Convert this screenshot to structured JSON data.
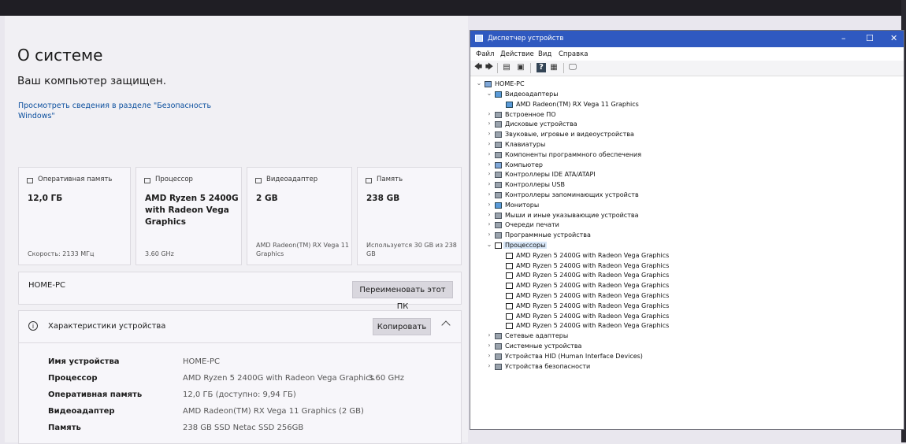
{
  "settings": {
    "title": "О системе",
    "protected_text": "Ваш компьютер защищен.",
    "security_link": "Просмотреть сведения в разделе \"Безопасность Windows\"",
    "cards": [
      {
        "label": "Оперативная память",
        "value": "12,0 ГБ",
        "sub": "Скорость: 2133 МГц"
      },
      {
        "label": "Процессор",
        "value": "AMD Ryzen 5 2400G with Radeon Vega Graphics",
        "sub": "3.60 GHz"
      },
      {
        "label": "Видеоадаптер",
        "value": "2 GB",
        "sub": "AMD Radeon(TM) RX Vega 11 Graphics"
      },
      {
        "label": "Память",
        "value": "238 GB",
        "sub": "Используется 30 GB из 238 GB"
      }
    ],
    "pc_name": "HOME-PC",
    "rename_button": "Переименовать этот ПК",
    "specs_title": "Характеристики устройства",
    "copy_button": "Копировать",
    "specs": [
      {
        "key": "Имя устройства",
        "value": "HOME-PC",
        "extra": ""
      },
      {
        "key": "Процессор",
        "value": "AMD Ryzen 5 2400G with Radeon Vega Graphics",
        "extra": "3.60 GHz"
      },
      {
        "key": "Оперативная память",
        "value": "12,0 ГБ (доступно: 9,94 ГБ)",
        "extra": ""
      },
      {
        "key": "Видеоадаптер",
        "value": "AMD Radeon(TM) RX Vega 11 Graphics (2 GB)",
        "extra": ""
      },
      {
        "key": "Память",
        "value": "238 GB SSD Netac SSD 256GB",
        "extra": ""
      }
    ]
  },
  "device_manager": {
    "title": "Диспетчер устройств",
    "menu": [
      "Файл",
      "Действие",
      "Вид",
      "Справка"
    ],
    "root": "HOME-PC",
    "nodes": [
      {
        "label": "Видеоадаптеры",
        "level": 1,
        "expanded": true,
        "icon": "display-adapter-icon"
      },
      {
        "label": "AMD Radeon(TM) RX Vega 11 Graphics",
        "level": 2,
        "icon": "display-adapter-icon"
      },
      {
        "label": "Встроенное ПО",
        "level": 1,
        "expanded": false,
        "icon": "firmware-icon"
      },
      {
        "label": "Дисковые устройства",
        "level": 1,
        "expanded": false,
        "icon": "disk-drive-icon"
      },
      {
        "label": "Звуковые, игровые и видеоустройства",
        "level": 1,
        "expanded": false,
        "icon": "sound-icon"
      },
      {
        "label": "Клавиатуры",
        "level": 1,
        "expanded": false,
        "icon": "keyboard-icon"
      },
      {
        "label": "Компоненты программного обеспечения",
        "level": 1,
        "expanded": false,
        "icon": "software-component-icon"
      },
      {
        "label": "Компьютер",
        "level": 1,
        "expanded": false,
        "icon": "computer-icon"
      },
      {
        "label": "Контроллеры IDE ATA/ATAPI",
        "level": 1,
        "expanded": false,
        "icon": "ide-controller-icon"
      },
      {
        "label": "Контроллеры USB",
        "level": 1,
        "expanded": false,
        "icon": "usb-icon"
      },
      {
        "label": "Контроллеры запоминающих устройств",
        "level": 1,
        "expanded": false,
        "icon": "storage-controller-icon"
      },
      {
        "label": "Мониторы",
        "level": 1,
        "expanded": false,
        "icon": "monitor-icon"
      },
      {
        "label": "Мыши и иные указывающие устройства",
        "level": 1,
        "expanded": false,
        "icon": "mouse-icon"
      },
      {
        "label": "Очереди печати",
        "level": 1,
        "expanded": false,
        "icon": "printer-icon"
      },
      {
        "label": "Программные устройства",
        "level": 1,
        "expanded": false,
        "icon": "software-device-icon"
      },
      {
        "label": "Процессоры",
        "level": 1,
        "expanded": true,
        "icon": "processor-icon"
      },
      {
        "label": "AMD Ryzen 5 2400G with Radeon Vega Graphics",
        "level": 2,
        "icon": "processor-icon"
      },
      {
        "label": "AMD Ryzen 5 2400G with Radeon Vega Graphics",
        "level": 2,
        "icon": "processor-icon"
      },
      {
        "label": "AMD Ryzen 5 2400G with Radeon Vega Graphics",
        "level": 2,
        "icon": "processor-icon"
      },
      {
        "label": "AMD Ryzen 5 2400G with Radeon Vega Graphics",
        "level": 2,
        "icon": "processor-icon"
      },
      {
        "label": "AMD Ryzen 5 2400G with Radeon Vega Graphics",
        "level": 2,
        "icon": "processor-icon"
      },
      {
        "label": "AMD Ryzen 5 2400G with Radeon Vega Graphics",
        "level": 2,
        "icon": "processor-icon"
      },
      {
        "label": "AMD Ryzen 5 2400G with Radeon Vega Graphics",
        "level": 2,
        "icon": "processor-icon"
      },
      {
        "label": "AMD Ryzen 5 2400G with Radeon Vega Graphics",
        "level": 2,
        "icon": "processor-icon"
      },
      {
        "label": "Сетевые адаптеры",
        "level": 1,
        "expanded": false,
        "icon": "network-adapter-icon"
      },
      {
        "label": "Системные устройства",
        "level": 1,
        "expanded": false,
        "icon": "system-device-icon"
      },
      {
        "label": "Устройства HID (Human Interface Devices)",
        "level": 1,
        "expanded": false,
        "icon": "hid-icon"
      },
      {
        "label": "Устройства безопасности",
        "level": 1,
        "expanded": false,
        "icon": "security-device-icon"
      }
    ]
  },
  "colors": {
    "titlebar": "#2f59c0",
    "link": "#0b4f9e"
  }
}
